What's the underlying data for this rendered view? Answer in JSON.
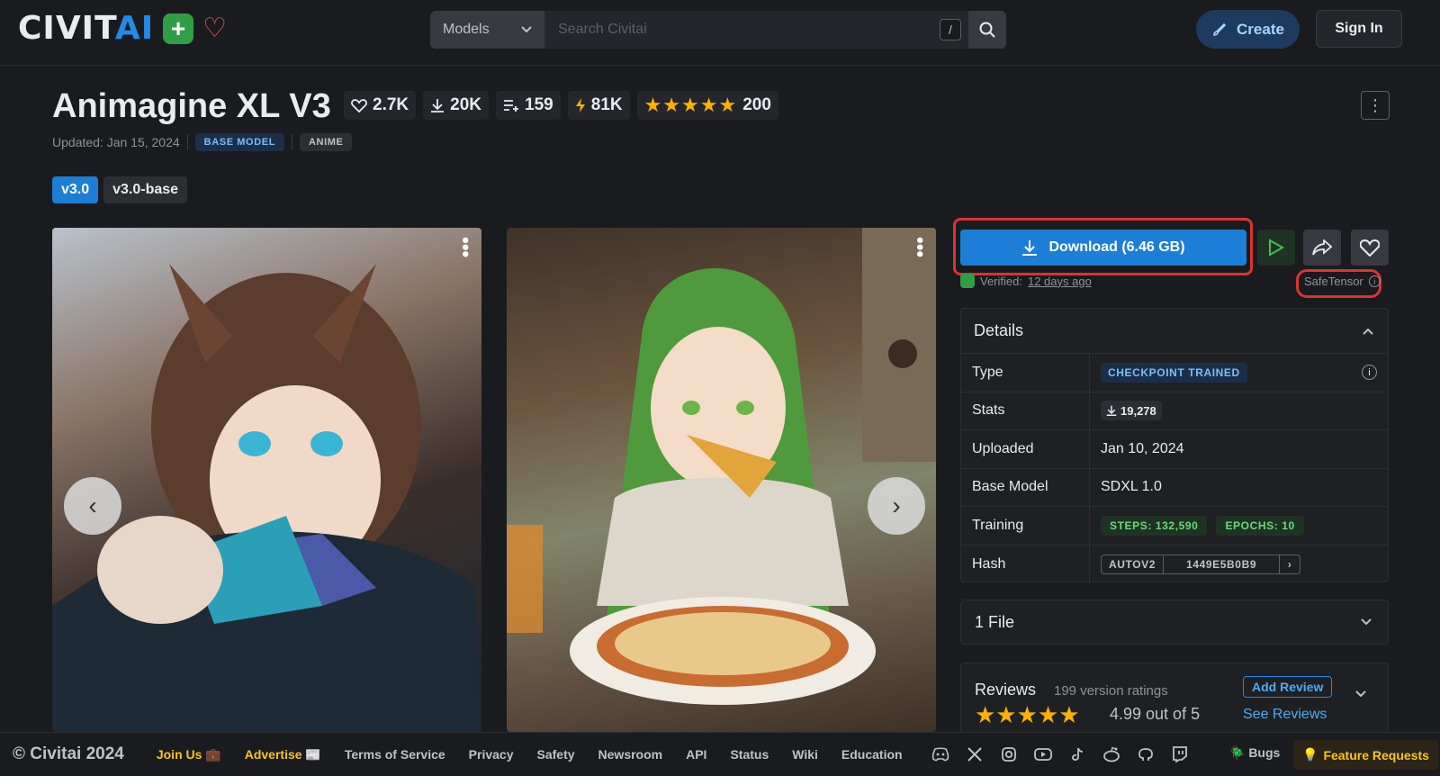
{
  "header": {
    "logo": {
      "text_main": "CIVIT",
      "text_accent": "AI"
    },
    "search": {
      "category": "Models",
      "placeholder": "Search Civitai",
      "shortcut": "/"
    },
    "create_label": "Create",
    "signin_label": "Sign In"
  },
  "model": {
    "title": "Animagine XL V3",
    "stats": {
      "likes": "2.7K",
      "downloads": "20K",
      "collections": "159",
      "buzz": "81K",
      "rating_count": "200"
    },
    "updated": "Updated: Jan 15, 2024",
    "badges": [
      "BASE MODEL",
      "ANIME"
    ],
    "versions": [
      "v3.0",
      "v3.0-base"
    ],
    "active_version": "v3.0"
  },
  "download": {
    "label": "Download (6.46 GB)",
    "verified_prefix": "Verified:",
    "verified_time": "12 days ago",
    "format": "SafeTensor"
  },
  "details": {
    "heading": "Details",
    "rows": {
      "type_label": "Type",
      "type_value": "CHECKPOINT TRAINED",
      "stats_label": "Stats",
      "stats_value": "19,278",
      "uploaded_label": "Uploaded",
      "uploaded_value": "Jan 10, 2024",
      "base_label": "Base Model",
      "base_value": "SDXL 1.0",
      "training_label": "Training",
      "steps": "STEPS: 132,590",
      "epochs": "EPOCHS: 10",
      "hash_label": "Hash",
      "hash_type": "AUTOV2",
      "hash_value": "1449E5B0B9"
    }
  },
  "files": {
    "label": "1 File"
  },
  "reviews": {
    "title": "Reviews",
    "count": "199 version ratings",
    "score": "4.99 out of 5",
    "stars": 5,
    "add_label": "Add Review",
    "see_label": "See Reviews"
  },
  "footer": {
    "copyright": "© Civitai 2024",
    "join": "Join Us 💼",
    "advertise": "Advertise 📰",
    "links": [
      "Terms of Service",
      "Privacy",
      "Safety",
      "Newsroom",
      "API",
      "Status",
      "Wiki",
      "Education"
    ],
    "social_icons": [
      "discord-icon",
      "x-icon",
      "instagram-icon",
      "youtube-icon",
      "tiktok-icon",
      "reddit-icon",
      "github-icon",
      "twitch-icon"
    ],
    "bugs": "🪲 Bugs",
    "feature": "Feature Requests"
  },
  "colors": {
    "accent": "#1c7ed6",
    "star": "#fab005",
    "highlight": "#e03131"
  }
}
